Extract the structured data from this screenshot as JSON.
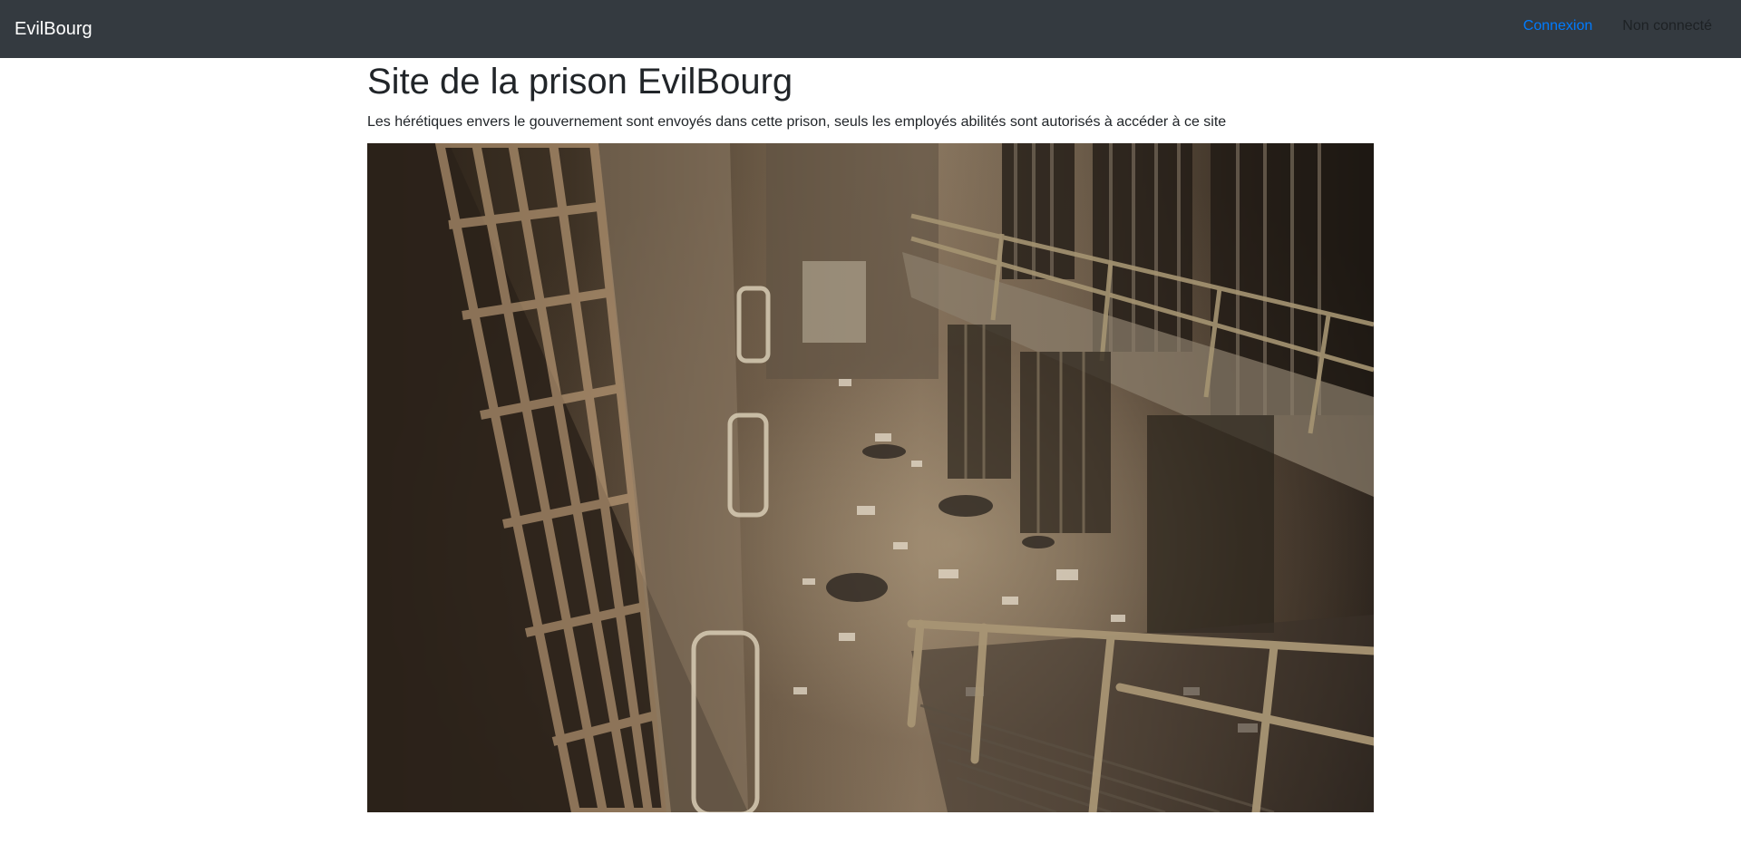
{
  "navbar": {
    "brand": "EvilBourg",
    "login_link": "Connexion",
    "status_text": "Non connecté"
  },
  "main": {
    "title": "Site de la prison EvilBourg",
    "subtitle": "Les hérétiques envers le gouvernement sont envoyés dans cette prison, seuls les employés abilités sont autorisés à accéder à ce site",
    "image": {
      "description_icon": "prison-interior-photo"
    }
  },
  "colors": {
    "navbar_bg": "#343a40",
    "brand": "#ffffff",
    "link": "#007bff",
    "text": "#212529"
  }
}
